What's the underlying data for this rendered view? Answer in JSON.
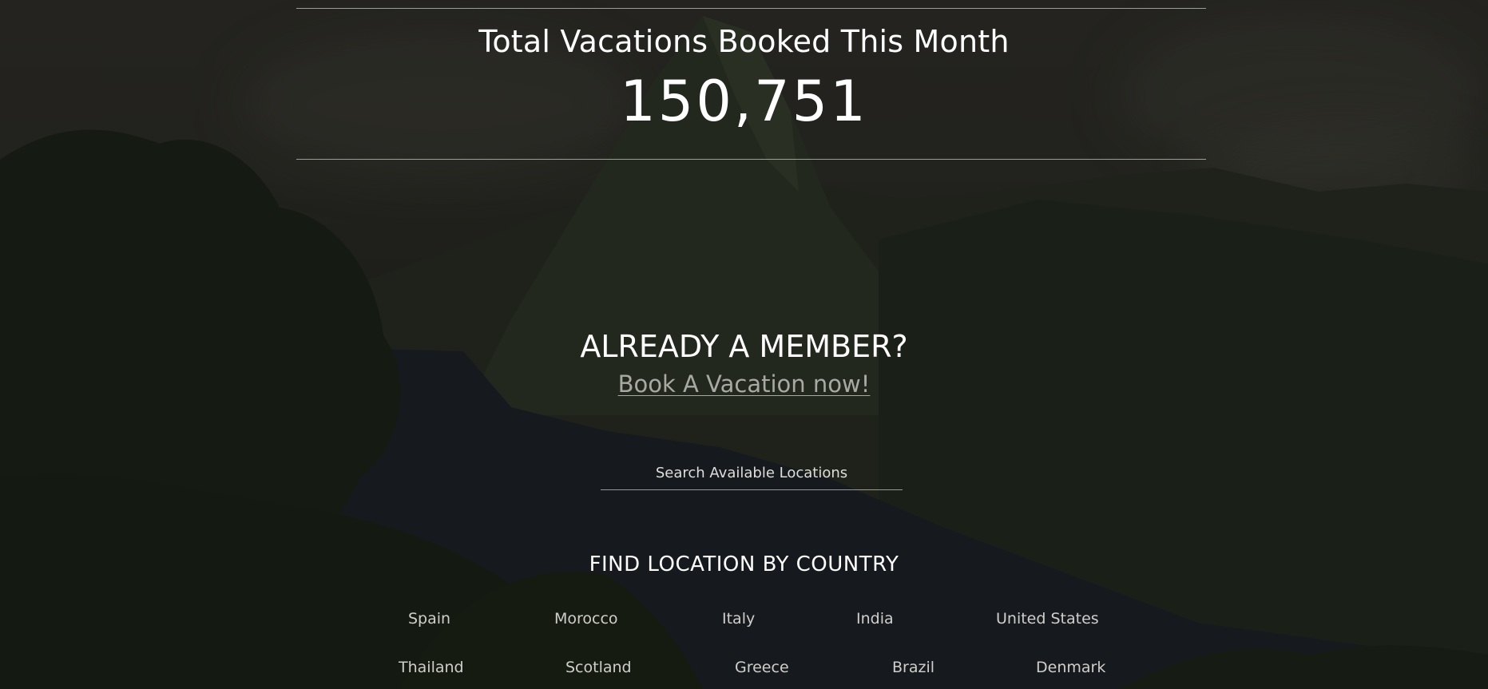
{
  "stats": {
    "title": "Total Vacations Booked This Month",
    "count": "150,751"
  },
  "member": {
    "title": "ALREADY A MEMBER?",
    "link_label": "Book A Vacation now!"
  },
  "search": {
    "placeholder": "Search Available Locations"
  },
  "countries": {
    "title": "FIND LOCATION BY COUNTRY",
    "row1": [
      "Spain",
      "Morocco",
      "Italy",
      "India",
      "United States"
    ],
    "row2": [
      "Thailand",
      "Scotland",
      "Greece",
      "Brazil",
      "Denmark"
    ]
  },
  "colors": {
    "text": "#ffffff",
    "link": "#a9a9a4",
    "country_text": "#cfcfca",
    "rule": "#8c8c88"
  }
}
